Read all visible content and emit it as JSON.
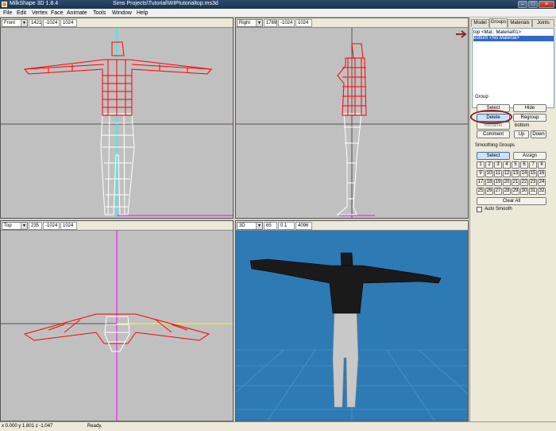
{
  "titlebar": {
    "app_title": "MilkShape 3D 1.8.4",
    "doc_title": "Sims Projects\\Tutorial\\WIPtutorialtop.ms3d",
    "minimize": "–",
    "maximize": "□",
    "close": "×"
  },
  "menu": {
    "items": [
      "File",
      "Edit",
      "Vertex",
      "Face",
      "Animate",
      "Tools",
      "Window",
      "Help"
    ]
  },
  "viewports": [
    {
      "view": "Front",
      "values": [
        "1421",
        "-1024",
        "1024"
      ]
    },
    {
      "view": "Right",
      "values": [
        "1789",
        "-1024",
        "1024"
      ]
    },
    {
      "view": "Top",
      "values": [
        "235",
        "-1024",
        "1024"
      ]
    },
    {
      "view": "3D",
      "values": [
        "65",
        "0.1",
        "4096"
      ]
    }
  ],
  "panel": {
    "tabs": [
      "Model",
      "Groups",
      "Materials",
      "Joints"
    ],
    "active_tab": "Groups",
    "group_list": [
      {
        "label": "top <Mat.: Material01>",
        "selected": false
      },
      {
        "label": "bottom <No Material>",
        "selected": true
      }
    ],
    "group_section": {
      "label": "Group",
      "select": "Select",
      "hide": "Hide",
      "delete": "Delete",
      "regroup": "Regroup",
      "rename": "Rename",
      "rename_value": "bottom",
      "comment": "Comment",
      "up": "Up",
      "down": "Down"
    },
    "smoothing": {
      "label": "Smoothing Groups",
      "select": "Select",
      "assign": "Assign",
      "numbers": [
        "1",
        "2",
        "3",
        "4",
        "5",
        "6",
        "7",
        "8",
        "9",
        "10",
        "11",
        "12",
        "13",
        "14",
        "15",
        "16",
        "17",
        "18",
        "19",
        "20",
        "21",
        "22",
        "23",
        "24",
        "25",
        "26",
        "27",
        "28",
        "29",
        "30",
        "31",
        "32"
      ],
      "clear_all": "Clear All",
      "auto_smooth": "Auto Smooth"
    }
  },
  "status": {
    "coords": "x 0.000 y 1.801 z -1.047",
    "message": "Ready."
  },
  "colors": {
    "selected_mesh": "#ff0000",
    "unselected_mesh": "#ffffff",
    "viewport_bg": "#c0c0c0",
    "view3d_bg": "#2e7ab5",
    "list_selected": "#316ac5",
    "annotation": "#8a2a2a"
  }
}
